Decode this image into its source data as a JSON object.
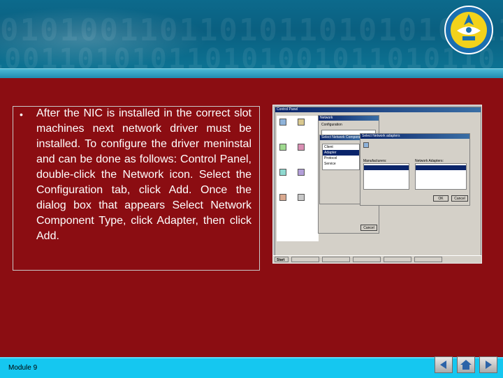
{
  "slide": {
    "bullet_text": "After the NIC is installed in the correct slot machines next network driver must be installed. To configure the driver meninstal and can be done as follows: Control Panel, double-click the Network icon. Select the Configuration tab, click Add. Once the dialog box that appears Select Network Component Type, click Adapter, then click Add."
  },
  "screenshot": {
    "control_panel_title": "Control Panel",
    "network_title": "Network",
    "select_component_title": "Select Network Component Type",
    "select_adapter_title": "Select Network adapters",
    "tab_configuration": "Configuration",
    "component_items": [
      "Client",
      "Adapter",
      "Protocol",
      "Service"
    ],
    "manufacturers_label": "Manufacturers:",
    "network_adapters_label": "Network Adapters:",
    "ok_label": "OK",
    "cancel_label": "Cancel",
    "start_label": "Start"
  },
  "footer": {
    "module_label": "Module 9"
  },
  "nav": {
    "prev_icon": "triangle-left-icon",
    "home_icon": "house-icon",
    "next_icon": "triangle-right-icon"
  },
  "colors": {
    "slide_bg": "#8b0d12",
    "header_bg": "#0c6a8c",
    "footer_bg": "#15c7f0"
  }
}
